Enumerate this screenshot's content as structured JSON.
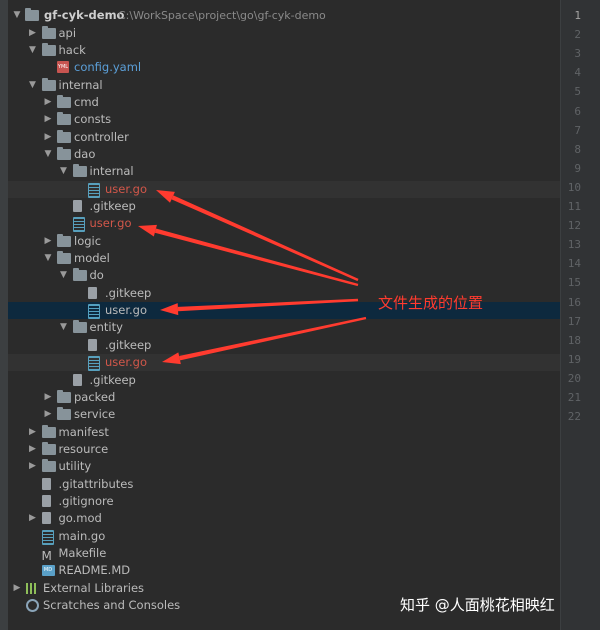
{
  "project": {
    "name": "gf-cyk-demo",
    "path": "C:\\WorkSpace\\project\\go\\gf-cyk-demo"
  },
  "tree": [
    {
      "label": "api",
      "kind": "folder",
      "depth": 1,
      "expand": "collapsed"
    },
    {
      "label": "hack",
      "kind": "folder",
      "depth": 1,
      "expand": "expanded"
    },
    {
      "label": "config.yaml",
      "kind": "yaml",
      "depth": 2,
      "color": "blue"
    },
    {
      "label": "internal",
      "kind": "folder",
      "depth": 1,
      "expand": "expanded"
    },
    {
      "label": "cmd",
      "kind": "folder",
      "depth": 2,
      "expand": "collapsed"
    },
    {
      "label": "consts",
      "kind": "folder",
      "depth": 2,
      "expand": "collapsed"
    },
    {
      "label": "controller",
      "kind": "folder",
      "depth": 2,
      "expand": "collapsed"
    },
    {
      "label": "dao",
      "kind": "folder",
      "depth": 2,
      "expand": "expanded"
    },
    {
      "label": "internal",
      "kind": "folder",
      "depth": 3,
      "expand": "expanded"
    },
    {
      "label": "user.go",
      "kind": "go",
      "depth": 4,
      "color": "red",
      "highlight": "gray"
    },
    {
      "label": ".gitkeep",
      "kind": "file",
      "depth": 3
    },
    {
      "label": "user.go",
      "kind": "go",
      "depth": 3,
      "color": "red"
    },
    {
      "label": "logic",
      "kind": "folder",
      "depth": 2,
      "expand": "collapsed"
    },
    {
      "label": "model",
      "kind": "folder",
      "depth": 2,
      "expand": "expanded"
    },
    {
      "label": "do",
      "kind": "folder",
      "depth": 3,
      "expand": "expanded"
    },
    {
      "label": ".gitkeep",
      "kind": "file",
      "depth": 4
    },
    {
      "label": "user.go",
      "kind": "go",
      "depth": 4,
      "highlight": "blue"
    },
    {
      "label": "entity",
      "kind": "folder",
      "depth": 3,
      "expand": "expanded"
    },
    {
      "label": ".gitkeep",
      "kind": "file",
      "depth": 4
    },
    {
      "label": "user.go",
      "kind": "go",
      "depth": 4,
      "color": "red",
      "highlight": "gray"
    },
    {
      "label": ".gitkeep",
      "kind": "file",
      "depth": 3
    },
    {
      "label": "packed",
      "kind": "folder",
      "depth": 2,
      "expand": "collapsed"
    },
    {
      "label": "service",
      "kind": "folder",
      "depth": 2,
      "expand": "collapsed"
    },
    {
      "label": "manifest",
      "kind": "folder",
      "depth": 1,
      "expand": "collapsed"
    },
    {
      "label": "resource",
      "kind": "folder",
      "depth": 1,
      "expand": "collapsed"
    },
    {
      "label": "utility",
      "kind": "folder",
      "depth": 1,
      "expand": "collapsed"
    },
    {
      "label": ".gitattributes",
      "kind": "file",
      "depth": 1
    },
    {
      "label": ".gitignore",
      "kind": "file",
      "depth": 1
    },
    {
      "label": "go.mod",
      "kind": "file",
      "depth": 1,
      "expand": "collapsed"
    },
    {
      "label": "main.go",
      "kind": "go",
      "depth": 1
    },
    {
      "label": "Makefile",
      "kind": "makefile",
      "depth": 1
    },
    {
      "label": "README.MD",
      "kind": "md",
      "depth": 1
    },
    {
      "label": "External Libraries",
      "kind": "lib",
      "depth": 0,
      "expand": "collapsed"
    },
    {
      "label": "Scratches and Consoles",
      "kind": "scratch",
      "depth": 0
    }
  ],
  "icon_names": {
    "folder": "folder-icon",
    "go": "go-file-icon",
    "file": "file-icon",
    "yaml": "yaml-file-icon",
    "md": "markdown-file-icon",
    "makefile": "makefile-icon",
    "lib": "external-libraries-icon",
    "scratch": "scratches-icon"
  },
  "icon_text": {
    "yaml": "YML",
    "md": "MD",
    "makefile": "M"
  },
  "gutter_lines": [
    "1",
    "2",
    "3",
    "4",
    "5",
    "6",
    "7",
    "8",
    "9",
    "10",
    "11",
    "12",
    "13",
    "14",
    "15",
    "16",
    "17",
    "18",
    "19",
    "20",
    "21",
    "22"
  ],
  "annotation": "文件生成的位置",
  "watermark": "知乎 @人面桃花相映红",
  "colors": {
    "background": "#2b2b2b",
    "highlight_gray": "#323232",
    "highlight_blue": "#0d293e",
    "vcs_new_red": "#d2574a",
    "link_blue": "#5b9fd8",
    "arrow_red": "#ff3b2f"
  }
}
